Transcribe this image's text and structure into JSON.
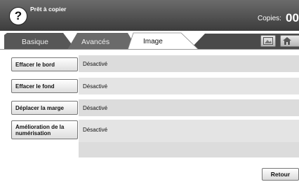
{
  "header": {
    "help_glyph": "?",
    "status": "Prêt à copier",
    "copies_label": "Copies:",
    "copies_value": "00"
  },
  "tabs": [
    {
      "label": "Basique"
    },
    {
      "label": "Avancés"
    },
    {
      "label": "Image",
      "selected": true
    }
  ],
  "tab_icons": [
    "image-icon",
    "home-icon"
  ],
  "options": [
    {
      "label": "Effacer le bord",
      "value": "Désactivé"
    },
    {
      "label": "Effacer le fond",
      "value": "Désactivé"
    },
    {
      "label": "Déplacer la marge",
      "value": "Désactivé"
    },
    {
      "label": "Amélioration de la numérisation",
      "value": "Désactivé"
    }
  ],
  "footer": {
    "back_label": "Retour"
  },
  "colors": {
    "header": "#4a4a4a",
    "row": "#dcdcdc",
    "tab_dark": "#555555"
  }
}
